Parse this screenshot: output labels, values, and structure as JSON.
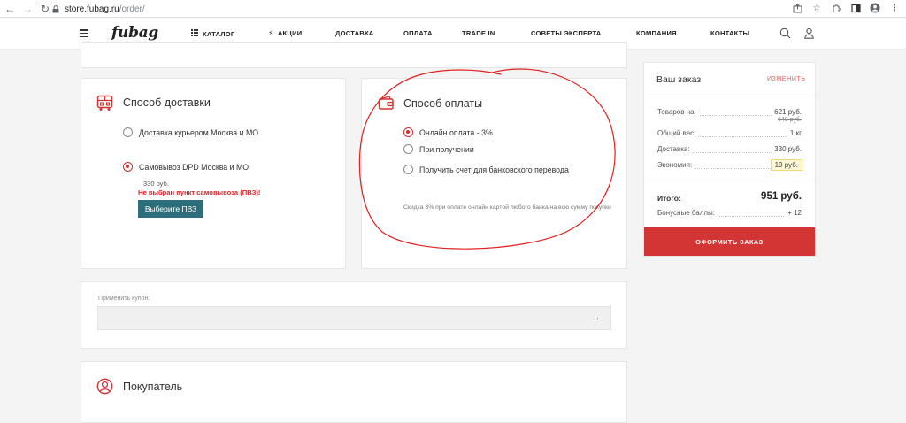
{
  "browser": {
    "url_host": "store.fubag.ru",
    "url_path": "/order/"
  },
  "header": {
    "logo": "fubag",
    "menu": [
      {
        "label": "КАТАЛОГ",
        "icon": "grid-icon"
      },
      {
        "label": "АКЦИИ",
        "icon": "bolt-icon"
      },
      {
        "label": "ДОСТАВКА"
      },
      {
        "label": "ОПЛАТА"
      },
      {
        "label": "TRADE IN"
      },
      {
        "label": "СОВЕТЫ ЭКСПЕРТА"
      },
      {
        "label": "КОМПАНИЯ"
      },
      {
        "label": "КОНТАКТЫ"
      }
    ]
  },
  "delivery": {
    "title": "Способ доставки",
    "options": [
      {
        "label": "Доставка курьером Москва и МО",
        "checked": false
      },
      {
        "label": "Самовывоз DPD Москва и МО",
        "checked": true
      }
    ],
    "price": "330 руб.",
    "warning": "Не выбран пункт самовывоза (ПВЗ)!",
    "button": "Выберите ПВЗ"
  },
  "payment": {
    "title": "Способ оплаты",
    "options": [
      {
        "label": "Онлайн оплата - 3%",
        "checked": true
      },
      {
        "label": "При получении",
        "checked": false
      },
      {
        "label": "Получить счет для банковского перевода",
        "checked": false
      }
    ],
    "note": "Скидка 3% при оплате онлайн картой любого банка на всю сумму покупки"
  },
  "coupon": {
    "label": "Применить купон:",
    "value": "",
    "placeholder": ""
  },
  "buyer": {
    "title": "Покупатель"
  },
  "summary": {
    "title": "Ваш заказ",
    "edit": "ИЗМЕНИТЬ",
    "rows": {
      "goods_label": "Товаров на:",
      "goods_value": "621 руб.",
      "goods_old": "640 руб.",
      "weight_label": "Общий вес:",
      "weight_value": "1 кг",
      "delivery_label": "Доставка:",
      "delivery_value": "330 руб.",
      "economy_label": "Экономия:",
      "economy_value": "19 руб."
    },
    "total_label": "Итого:",
    "total_value": "951 руб.",
    "bonus_label": "Бонусные баллы:",
    "bonus_value": "+ 12",
    "submit": "ОФОРМИТЬ ЗАКАЗ"
  },
  "colors": {
    "accent": "#d33434",
    "pvz_button": "#2e6e7a",
    "warning": "#e31e24",
    "annotation": "#e02020"
  }
}
